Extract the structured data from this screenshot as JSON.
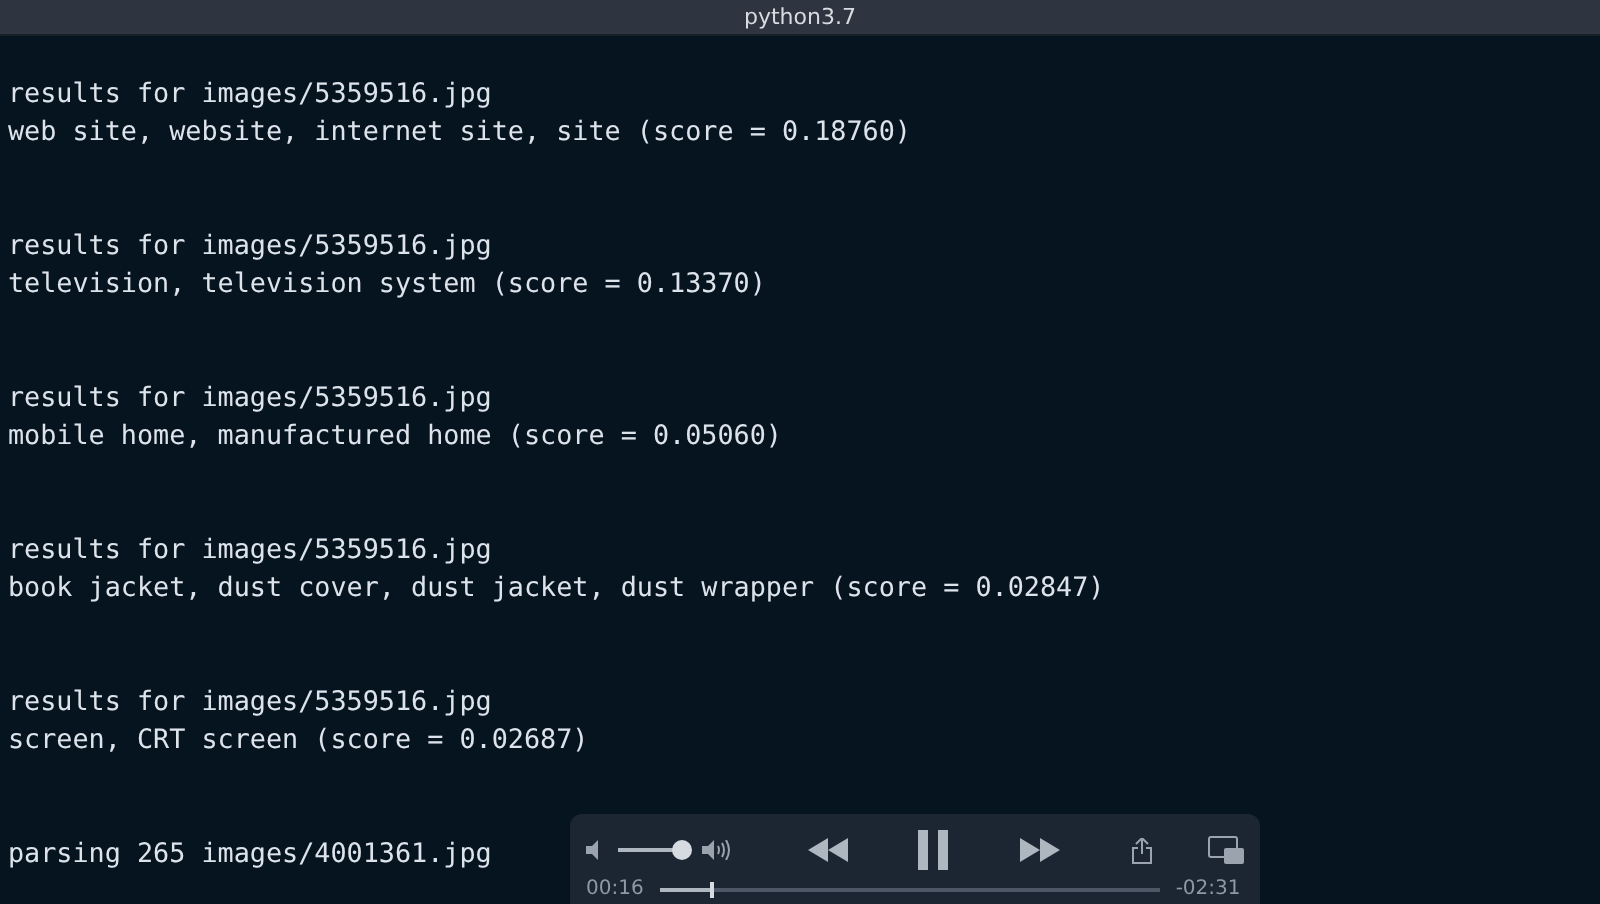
{
  "window": {
    "title": "python3.7"
  },
  "terminal": {
    "blocks": [
      {
        "lines": [
          "results for images/5359516.jpg",
          "web site, website, internet site, site (score = 0.18760)"
        ]
      },
      {
        "lines": [
          "results for images/5359516.jpg",
          "television, television system (score = 0.13370)"
        ]
      },
      {
        "lines": [
          "results for images/5359516.jpg",
          "mobile home, manufactured home (score = 0.05060)"
        ]
      },
      {
        "lines": [
          "results for images/5359516.jpg",
          "book jacket, dust cover, dust jacket, dust wrapper (score = 0.02847)"
        ]
      },
      {
        "lines": [
          "results for images/5359516.jpg",
          "screen, CRT screen (score = 0.02687)"
        ]
      },
      {
        "lines": [
          "parsing 265 images/4001361.jpg"
        ]
      }
    ]
  },
  "player": {
    "volume": {
      "level": 0.9
    },
    "playing": true,
    "elapsed": "00:16",
    "remaining": "-02:31",
    "progress": {
      "level": 0.1
    }
  }
}
